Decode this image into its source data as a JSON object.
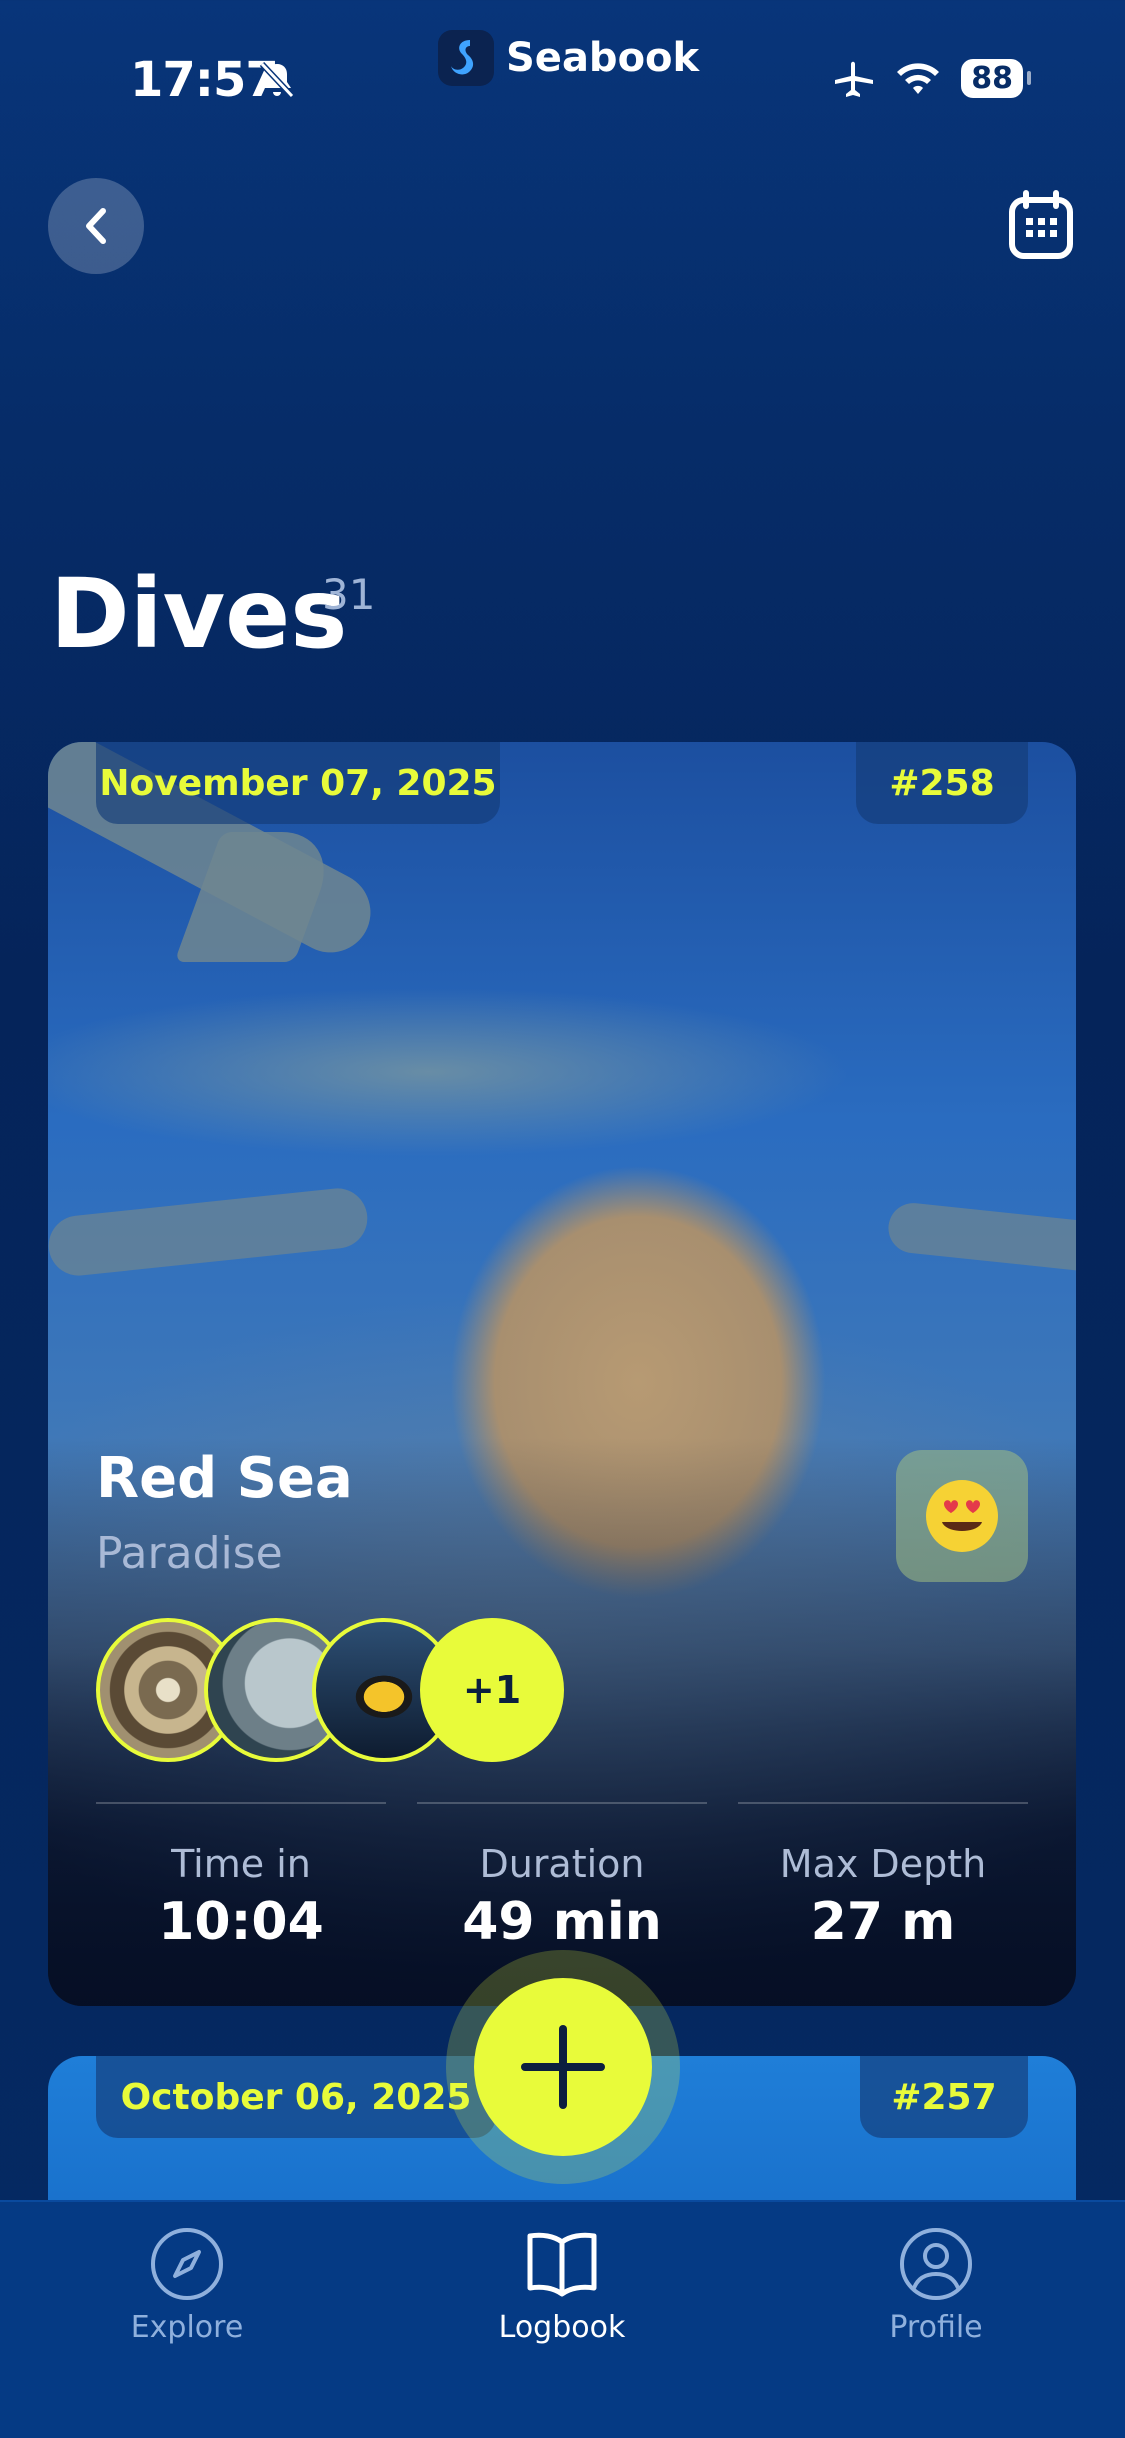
{
  "status_bar": {
    "time": "17:57",
    "battery": "88"
  },
  "brand": {
    "name": "Seabook"
  },
  "page": {
    "title": "Dives",
    "count": "31"
  },
  "cards": [
    {
      "date": "November 07, 2025",
      "number": "#258",
      "location": "Red Sea",
      "site": "Paradise",
      "extra_count": "+1",
      "stats": [
        {
          "label": "Time in",
          "value": "10:04"
        },
        {
          "label": "Duration",
          "value": "49 min"
        },
        {
          "label": "Max Depth",
          "value": "27 m"
        }
      ]
    },
    {
      "date": "October 06, 2025",
      "number": "#257"
    }
  ],
  "tabs": [
    {
      "label": "Explore",
      "icon": "compass-icon",
      "active": false
    },
    {
      "label": "Logbook",
      "icon": "book-icon",
      "active": true
    },
    {
      "label": "Profile",
      "icon": "person-icon",
      "active": false
    }
  ],
  "colors": {
    "accent": "#e8fb3a",
    "background": "#052a63",
    "tab_inactive": "#8fb0dd"
  }
}
